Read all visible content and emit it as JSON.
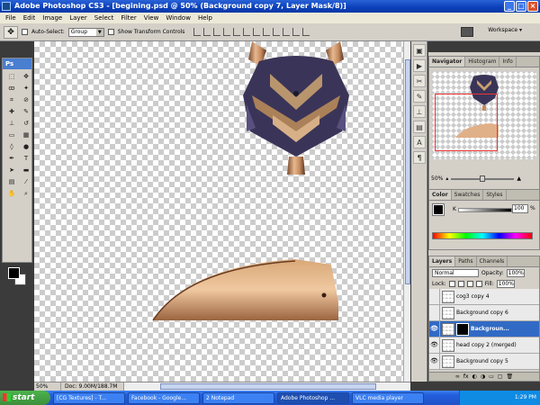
{
  "window": {
    "title": "Adobe Photoshop CS3 - [begining.psd @ 50% (Background copy 7, Layer Mask/8)]"
  },
  "menu": [
    "File",
    "Edit",
    "Image",
    "Layer",
    "Select",
    "Filter",
    "View",
    "Window",
    "Help"
  ],
  "options": {
    "auto_select_label": "Auto-Select:",
    "auto_select_value": "Group",
    "transform_label": "Show Transform Controls",
    "workspace_label": "Workspace ▾"
  },
  "toolbox": {
    "label": "Ps"
  },
  "status": {
    "zoom": "50%",
    "doc": "Doc: 9.00M/188.7M"
  },
  "navigator": {
    "tabs": [
      "Navigator",
      "Histogram",
      "Info"
    ],
    "zoom": "50%"
  },
  "color": {
    "tabs": [
      "Color",
      "Swatches",
      "Styles"
    ],
    "channel_label": "K",
    "channel_value": "100",
    "pct": "%"
  },
  "layers": {
    "tabs": [
      "Layers",
      "Paths",
      "Channels"
    ],
    "blend_mode": "Normal",
    "opacity_label": "Opacity:",
    "opacity_value": "100%",
    "lock_label": "Lock:",
    "fill_label": "Fill:",
    "fill_value": "100%",
    "rows": [
      {
        "name": "cog3 copy 4",
        "visible": false,
        "active": false
      },
      {
        "name": "Background copy 6",
        "visible": false,
        "active": false
      },
      {
        "name": "Backgroun...",
        "visible": true,
        "active": true
      },
      {
        "name": "head copy 2 (merged)",
        "visible": true,
        "active": false
      },
      {
        "name": "Background copy 5",
        "visible": true,
        "active": false
      }
    ]
  },
  "taskbar": {
    "start": "start",
    "tasks": [
      "[CG Textures] - T...",
      "Facebook - Google...",
      "2 Notepad",
      "Adobe Photoshop ...",
      "VLC media player"
    ],
    "clock": "1:29 PM"
  },
  "colors": {
    "accent": "#316ac5",
    "titlebar": "#0a3fb8"
  }
}
